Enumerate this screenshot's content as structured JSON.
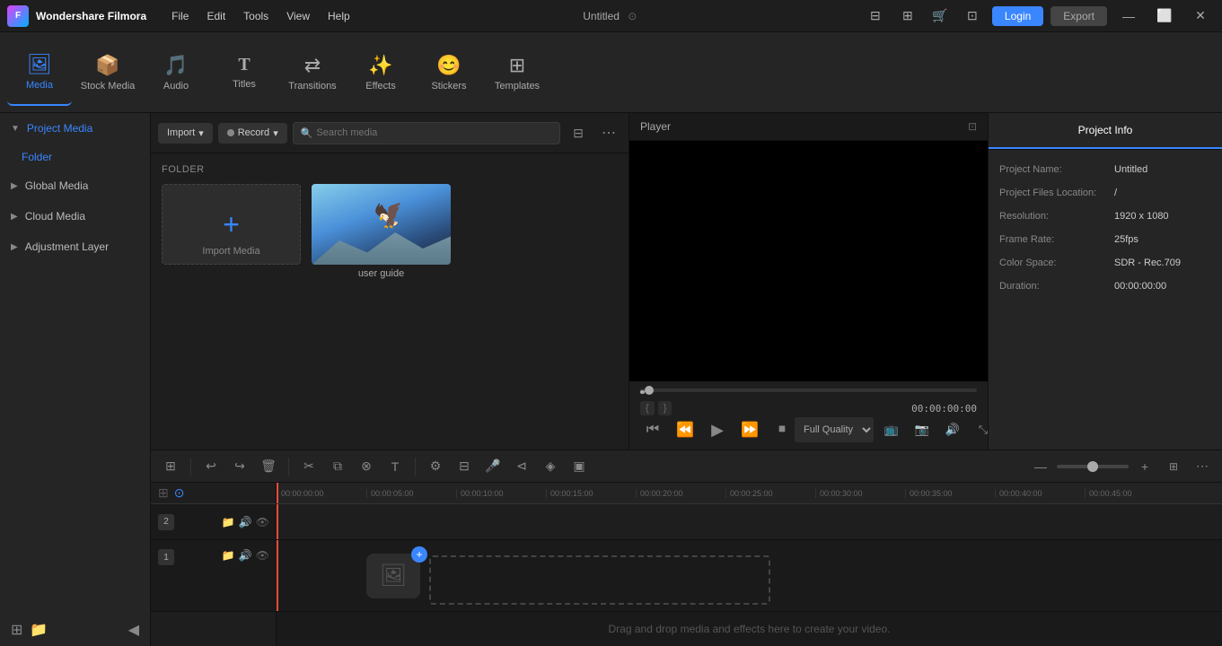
{
  "app": {
    "name": "Wondershare Filmora",
    "title": "Untitled"
  },
  "menu": {
    "items": [
      "File",
      "Edit",
      "Tools",
      "View",
      "Help"
    ]
  },
  "titlebar": {
    "login_label": "Login",
    "export_label": "Export"
  },
  "toolbar": {
    "items": [
      {
        "id": "media",
        "label": "Media",
        "icon": "🖼"
      },
      {
        "id": "stock",
        "label": "Stock Media",
        "icon": "📦"
      },
      {
        "id": "audio",
        "label": "Audio",
        "icon": "🎵"
      },
      {
        "id": "titles",
        "label": "Titles",
        "icon": "T"
      },
      {
        "id": "transitions",
        "label": "Transitions",
        "icon": "⇄"
      },
      {
        "id": "effects",
        "label": "Effects",
        "icon": "✨"
      },
      {
        "id": "stickers",
        "label": "Stickers",
        "icon": "😊"
      },
      {
        "id": "templates",
        "label": "Templates",
        "icon": "⊞"
      }
    ]
  },
  "left_panel": {
    "items": [
      {
        "id": "project-media",
        "label": "Project Media",
        "active": true
      },
      {
        "id": "global-media",
        "label": "Global Media"
      },
      {
        "id": "cloud-media",
        "label": "Cloud Media"
      },
      {
        "id": "adjustment-layer",
        "label": "Adjustment Layer"
      }
    ],
    "folder_label": "Folder"
  },
  "media_panel": {
    "import_label": "Import",
    "record_label": "Record",
    "search_placeholder": "Search media",
    "folder_label": "FOLDER",
    "items": [
      {
        "id": "import",
        "name": "Import Media",
        "type": "import"
      },
      {
        "id": "user-guide",
        "name": "user guide",
        "type": "video"
      }
    ]
  },
  "player": {
    "title": "Player",
    "time": "00:00:00:00",
    "quality": "Full Quality",
    "quality_arrow": "▾"
  },
  "project_info": {
    "tab_label": "Project Info",
    "fields": [
      {
        "label": "Project Name:",
        "value": "Untitled"
      },
      {
        "label": "Project Files Location:",
        "value": "/"
      },
      {
        "label": "Resolution:",
        "value": "1920 x 1080"
      },
      {
        "label": "Frame Rate:",
        "value": "25fps"
      },
      {
        "label": "Color Space:",
        "value": "SDR - Rec.709"
      },
      {
        "label": "Duration:",
        "value": "00:00:00:00"
      }
    ]
  },
  "timeline": {
    "drop_text": "Drag and drop media and effects here to create your video.",
    "time_labels": [
      "00:00:00:00",
      "00:00:05:00",
      "00:00:10:00",
      "00:00:15:00",
      "00:00:20:00",
      "00:00:25:00",
      "00:00:30:00",
      "00:00:35:00",
      "00:00:40:00",
      "00:00:45:00"
    ],
    "tracks": [
      {
        "num": "2",
        "type": "video"
      },
      {
        "num": "1",
        "type": "video"
      }
    ]
  }
}
